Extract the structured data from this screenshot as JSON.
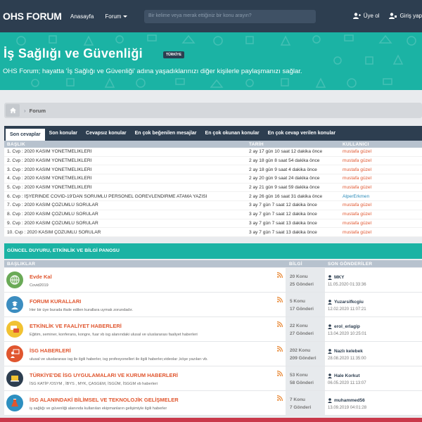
{
  "nav": {
    "logo": "OHS FORUM",
    "home": "Anasayfa",
    "forum": "Forum",
    "search_placeholder": "Bir kelime veya merak ettiğiniz bir konu arayın?",
    "register": "Üye ol",
    "login": "Giriş yap"
  },
  "hero": {
    "title": "İş Sağlığı ve Güvenliği",
    "badge": "TÜRKİYE",
    "subtitle": "OHS Forum; hayatta 'İş Sağlığı ve Güvenliği' adına yaşadıklarınızı diğer kişilerle paylaşmanızı sağlar."
  },
  "breadcrumb": {
    "label": "Forum"
  },
  "tabs": [
    "Son cevaplar",
    "Son konular",
    "Cevapsız konular",
    "En çok beğenilen mesajlar",
    "En çok okunan konular",
    "En çok cevap verilen konular"
  ],
  "latest": {
    "headers": {
      "title": "BAŞLIK",
      "date": "TARİH",
      "user": "KULLANICI"
    },
    "rows": [
      {
        "title": "1. Cvp : 2020 KASIM YÖNETMELİKLERİ",
        "date": "2 ay 17 gün 10 saat 12 dakika önce",
        "user": "mustafa güzel"
      },
      {
        "title": "2. Cvp : 2020 KASIM YÖNETMELİKLERİ",
        "date": "2 ay 18 gün 8 saat 54 dakika önce",
        "user": "mustafa güzel"
      },
      {
        "title": "3. Cvp : 2020 KASIM YÖNETMELİKLERİ",
        "date": "2 ay 18 gün 9 saat 4 dakika önce",
        "user": "mustafa güzel"
      },
      {
        "title": "4. Cvp : 2020 KASIM YÖNETMELİKLERİ",
        "date": "2 ay 20 gün 9 saat 24 dakika önce",
        "user": "mustafa güzel"
      },
      {
        "title": "5. Cvp : 2020 KASIM YÖNETMELİKLERİ",
        "date": "2 ay 21 gün 9 saat 59 dakika önce",
        "user": "mustafa güzel"
      },
      {
        "title": "6. Cvp : İŞYERİNDE COVID-19'DAN SORUMLU PERSONEL GÖREVLENDİRME ATAMA YAZISI",
        "date": "2 ay 26 gün 16 saat 31 dakika önce",
        "user": "AlperErkmen",
        "blue": true
      },
      {
        "title": "7. Cvp : 2020 KASIM ÇÖZÜMLÜ SORULAR",
        "date": "3 ay 7 gün 7 saat 12 dakika önce",
        "user": "mustafa güzel"
      },
      {
        "title": "8. Cvp : 2020 KASIM ÇÖZÜMLÜ SORULAR",
        "date": "3 ay 7 gün 7 saat 12 dakika önce",
        "user": "mustafa güzel"
      },
      {
        "title": "9. Cvp : 2020 KASIM ÇÖZÜMLÜ SORULAR",
        "date": "3 ay 7 gün 7 saat 13 dakika önce",
        "user": "mustafa güzel"
      },
      {
        "title": "10. Cvp : 2020 KASIM ÇÖZÜMLÜ SORULAR",
        "date": "3 ay 7 gün 7 saat 13 dakika önce",
        "user": "mustafa güzel"
      }
    ]
  },
  "board": {
    "title": "GÜNCEL DUYURU, ETKİNLİK VE BİLGİ PANOSU",
    "headers": {
      "titles": "BAŞLIKLAR",
      "info": "BİLGİ",
      "last": "SON GÖNDERİLER"
    },
    "forums": [
      {
        "name": "Evde Kal",
        "desc": "Covid2019",
        "topics": "20 Konu",
        "posts": "25 Gönderi",
        "last_user": "MKY",
        "last_date": "11.05.2020 01:33:36",
        "icon": "globe-icon",
        "color": "#6aaa57"
      },
      {
        "name": "FORUM KURALLARI",
        "desc": "Her bir üye burada ifade edilen kurallara uymak zorundadır.",
        "topics": "5 Konu",
        "posts": "17 Gönderi",
        "last_user": "Yuzarsifkcgiu",
        "last_date": "12.02.2020 11:07:21",
        "icon": "worker-icon",
        "color": "#3c8dc0"
      },
      {
        "name": "ETKİNLİK VE FAALİYET HABERLERİ",
        "desc": "Eğitim, seminer, konferans, kongre, fuar vb isg alanındaki ulusal ve uluslararası faaliyet haberleri",
        "topics": "22 Konu",
        "posts": "27 Gönderi",
        "last_user": "erol_erlagip",
        "last_date": "13.04.2020 10:25:01",
        "icon": "chat-icon",
        "color": "#f1c232"
      },
      {
        "name": "İSG HABERLERİ",
        "desc": "ulusal ve uluslararası isg ile ilgili haberler, isg profesyonelleri ile ilgili haberler,videolar ,köşe yazıları vb.",
        "topics": "202 Konu",
        "posts": "209 Gönderi",
        "last_user": "Nazlı kelebek",
        "last_date": "28.08.2020 11:35:00",
        "icon": "presenter-icon",
        "color": "#e0562f"
      },
      {
        "name": "TÜRKİYE'DE İSG UYGULAMALARI VE KURUM HABERLERİ",
        "desc": "İSG KATİP /OSYM , İBYS , MYK, ÇASGEM, İSGÜM, İSGGM vb haberleri",
        "topics": "53 Konu",
        "posts": "58 Gönderi",
        "last_user": "Hale Korkut",
        "last_date": "06.05.2020 11:13:07",
        "icon": "laptop-icon",
        "color": "#2d3e50"
      },
      {
        "name": "İSG ALANINDAKİ BİLİMSEL VE TEKNOLOJİK GELİŞMELER",
        "desc": "iş sağlığı ve güvenliği alanında kullanılan ekipmanların gelişimiyle ilgili haberler",
        "topics": "7 Konu",
        "posts": "7 Gönderi",
        "last_user": "muhammed56",
        "last_date": "13.09.2019 04:01:28",
        "icon": "flask-icon",
        "color": "#2d8fc0"
      }
    ]
  }
}
